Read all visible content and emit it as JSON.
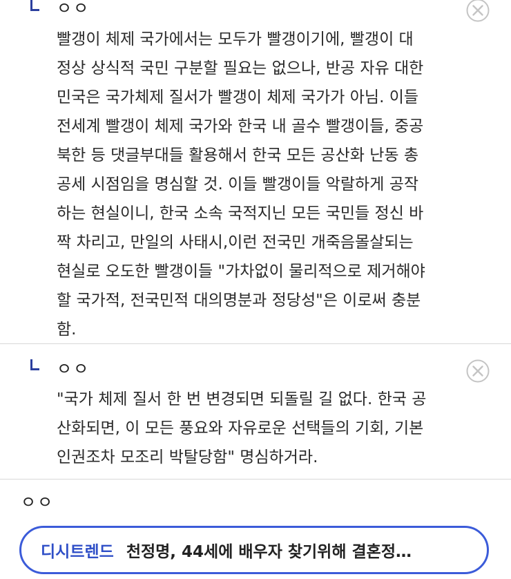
{
  "replies": [
    {
      "author": "ㅇㅇ",
      "lines": [
        "빨갱이 체제 국가에서는 모두가 빨갱이기에, 빨갱이 대",
        "정상 상식적 국민 구분할 필요는 없으나, 반공 자유 대한",
        "민국은 국가체제 질서가 빨갱이 체제 국가가 아님. 이들",
        "전세계 빨갱이 체제 국가와 한국 내 골수 빨갱이들, 중공",
        "북한 등 댓글부대들 활용해서 한국 모든 공산화 난동 총",
        "공세 시점임을 명심할 것. 이들 빨갱이들 악랄하게 공작",
        "하는 현실이니, 한국 소속 국적지닌 모든 국민들 정신 바",
        "짝 차리고, 만일의 사태시,이런 전국민 개죽음몰살되는",
        "현실로 오도한 빨갱이들 \"가차없이 물리적으로 제거해야",
        "할 국가적, 전국민적 대의명분과 정당성\"은 이로써 충분",
        "함."
      ]
    },
    {
      "author": "ㅇㅇ",
      "lines": [
        "\"국가 체제 질서 한 번 변경되면 되돌릴 길 없다. 한국 공",
        "산화되면, 이 모든 풍요와 자유로운 선택들의 기회, 기본",
        "인권조차 모조리 박탈당함\" 명심하거라."
      ]
    }
  ],
  "commenter": "ㅇㅇ",
  "trend": {
    "label": "디시트렌드",
    "title": "천정명, 44세에 배우자 찾기위해 결혼정…"
  },
  "colors": {
    "accent": "#3b5bd9",
    "reply_arrow": "#2b3f9e",
    "divider": "#d7d7d7",
    "delete_icon": "#c4c4c4"
  },
  "icons": {
    "reply_arrow": "reply-arrow-icon",
    "delete": "close-circle-icon"
  }
}
